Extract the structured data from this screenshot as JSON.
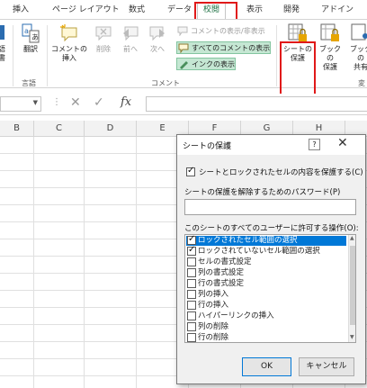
{
  "ribbon_tabs": [
    "挿入",
    "ページ レイアウト",
    "数式",
    "データ",
    "校閲",
    "表示",
    "開発",
    "アドイン"
  ],
  "active_tab": "校閲",
  "ribbon": {
    "left_partial": [
      "語",
      "書"
    ],
    "translate_label": "翻訳",
    "language_group": "言語",
    "new_comment_line1": "コメントの",
    "new_comment_line2": "挿入",
    "delete_label": "削除",
    "prev_label": "前へ",
    "next_label": "次へ",
    "show_hide_comment": "コメントの表示/非表示",
    "show_all_comments": "すべてのコメントの表示",
    "show_ink": "インクの表示",
    "comment_group": "コメント",
    "protect_sheet_line1": "シートの",
    "protect_sheet_line2": "保護",
    "protect_book_line1": "ブックの",
    "protect_book_line2": "保護",
    "share_book_line1": "ブックの",
    "share_book_line2": "共有",
    "change_group_partial": "変"
  },
  "formula_bar": {
    "fx": "fx"
  },
  "columns": [
    "B",
    "C",
    "D",
    "E",
    "F",
    "G",
    "H"
  ],
  "dialog": {
    "title": "シートの保護",
    "help": "?",
    "protect_check_label": "シートとロックされたセルの内容を保護する(C)",
    "protect_checked": true,
    "password_label": "シートの保護を解除するためのパスワード(P)",
    "password_value": "",
    "permissions_label": "このシートのすべてのユーザーに許可する操作(O):",
    "permissions": [
      {
        "label": "ロックされたセル範囲の選択",
        "checked": true,
        "selected": true
      },
      {
        "label": "ロックされていないセル範囲の選択",
        "checked": true,
        "selected": false
      },
      {
        "label": "セルの書式設定",
        "checked": false,
        "selected": false
      },
      {
        "label": "列の書式設定",
        "checked": false,
        "selected": false
      },
      {
        "label": "行の書式設定",
        "checked": false,
        "selected": false
      },
      {
        "label": "列の挿入",
        "checked": false,
        "selected": false
      },
      {
        "label": "行の挿入",
        "checked": false,
        "selected": false
      },
      {
        "label": "ハイパーリンクの挿入",
        "checked": false,
        "selected": false
      },
      {
        "label": "列の削除",
        "checked": false,
        "selected": false
      },
      {
        "label": "行の削除",
        "checked": false,
        "selected": false
      }
    ],
    "ok_label": "OK",
    "cancel_label": "キャンセル"
  },
  "colors": {
    "accent_green": "#217346",
    "highlight_red": "#e01919",
    "selection_blue": "#0078d7"
  }
}
